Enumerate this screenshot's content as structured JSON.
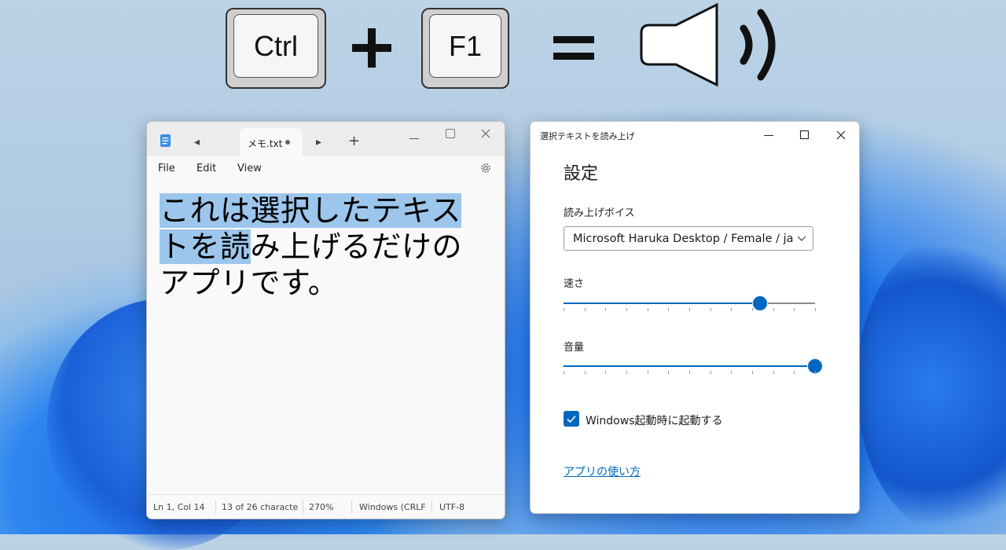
{
  "banner": {
    "key1": "Ctrl",
    "key2": "F1"
  },
  "notepad": {
    "tab_title": "メモ.txt",
    "menu": {
      "file": "File",
      "edit": "Edit",
      "view": "View"
    },
    "text_selected_1": "これは選択したテキス",
    "text_selected_2": "ト",
    "text_selected_3": "を読",
    "text_plain_2": "み上げるだけの",
    "text_line_3": "アプリです。",
    "status": {
      "position": "Ln 1, Col 14",
      "selection": "13 of 26 characte",
      "zoom": "270%",
      "line_ending": "Windows (CRLF",
      "encoding": "UTF-8"
    }
  },
  "settings": {
    "window_title": "選択テキストを読み上げ",
    "heading": "設定",
    "voice_label": "読み上げボイス",
    "voice_value": "Microsoft Haruka Desktop / Female / ja",
    "speed_label": "速さ",
    "speed_value": 0.78,
    "volume_label": "音量",
    "volume_value": 1.0,
    "startup_label": "Windows起動時に起動する",
    "startup_checked": true,
    "help_link": "アプリの使い方"
  },
  "colors": {
    "accent": "#0067c0",
    "selection": "#9cc6ec"
  }
}
